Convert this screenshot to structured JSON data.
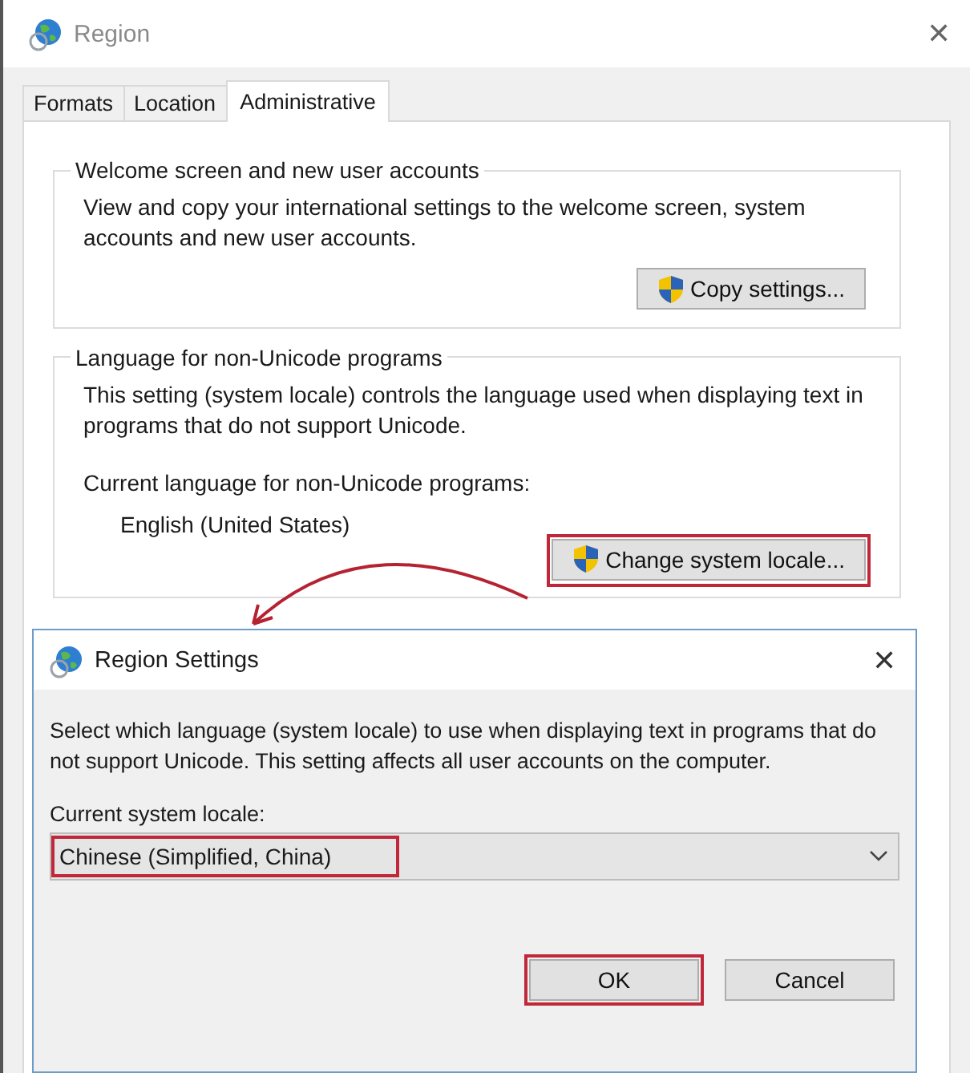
{
  "window": {
    "title": "Region",
    "close": "✕"
  },
  "tabs": [
    {
      "label": "Formats",
      "selected": false
    },
    {
      "label": "Location",
      "selected": false
    },
    {
      "label": "Administrative",
      "selected": true
    }
  ],
  "groups": [
    {
      "title": "Welcome screen and new user accounts",
      "text": "View and copy your international settings to the welcome screen, system accounts and new user accounts.",
      "button": {
        "label": "Copy settings...",
        "highlighted": false
      }
    },
    {
      "title": "Language for non-Unicode programs",
      "text": "This setting (system locale) controls the language used when displaying text in programs that do not support Unicode.",
      "current_label": "Current language for non-Unicode programs:",
      "current_value": "English (United States)",
      "button": {
        "label": "Change system locale...",
        "highlighted": true
      }
    }
  ],
  "dialog": {
    "title": "Region Settings",
    "close": "✕",
    "text": "Select which language (system locale) to use when displaying text in programs that do not support Unicode. This setting affects all user accounts on the computer.",
    "locale_label": "Current system locale:",
    "locale": {
      "value": "Chinese (Simplified, China)",
      "highlighted": true
    },
    "buttons": [
      {
        "label": "OK",
        "highlighted": true
      },
      {
        "label": "Cancel",
        "highlighted": false
      }
    ]
  }
}
